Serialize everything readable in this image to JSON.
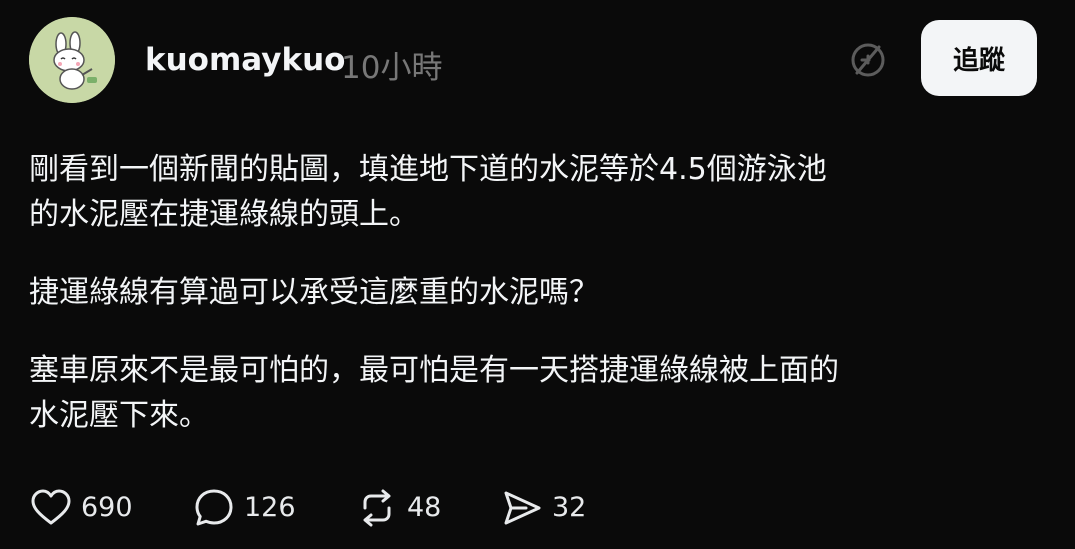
{
  "post": {
    "author": "kuomaykuo",
    "time": "10小時",
    "follow_label": "追蹤",
    "paragraphs": [
      "剛看到一個新聞的貼圖，填進地下道的水泥等於4.5個游泳池\n的水泥壓在捷運綠線的頭上。",
      "捷運綠線有算過可以承受這麼重的水泥嗎？",
      "塞車原來不是最可怕的，最可怕是有一天搭捷運綠線被上面的\n水泥壓下來。"
    ]
  },
  "actions": {
    "likes": "690",
    "replies": "126",
    "reposts": "48",
    "shares": "32"
  },
  "icons": {
    "avatar": "bunny-avatar-icon",
    "mute": "mute-icon",
    "like": "heart-icon",
    "reply": "speech-bubble-icon",
    "repost": "repost-arrows-icon",
    "share": "send-icon"
  },
  "colors": {
    "background": "#0a0a0a",
    "text": "#f3f5f7",
    "muted": "#777777",
    "button_bg": "#f3f5f7"
  }
}
